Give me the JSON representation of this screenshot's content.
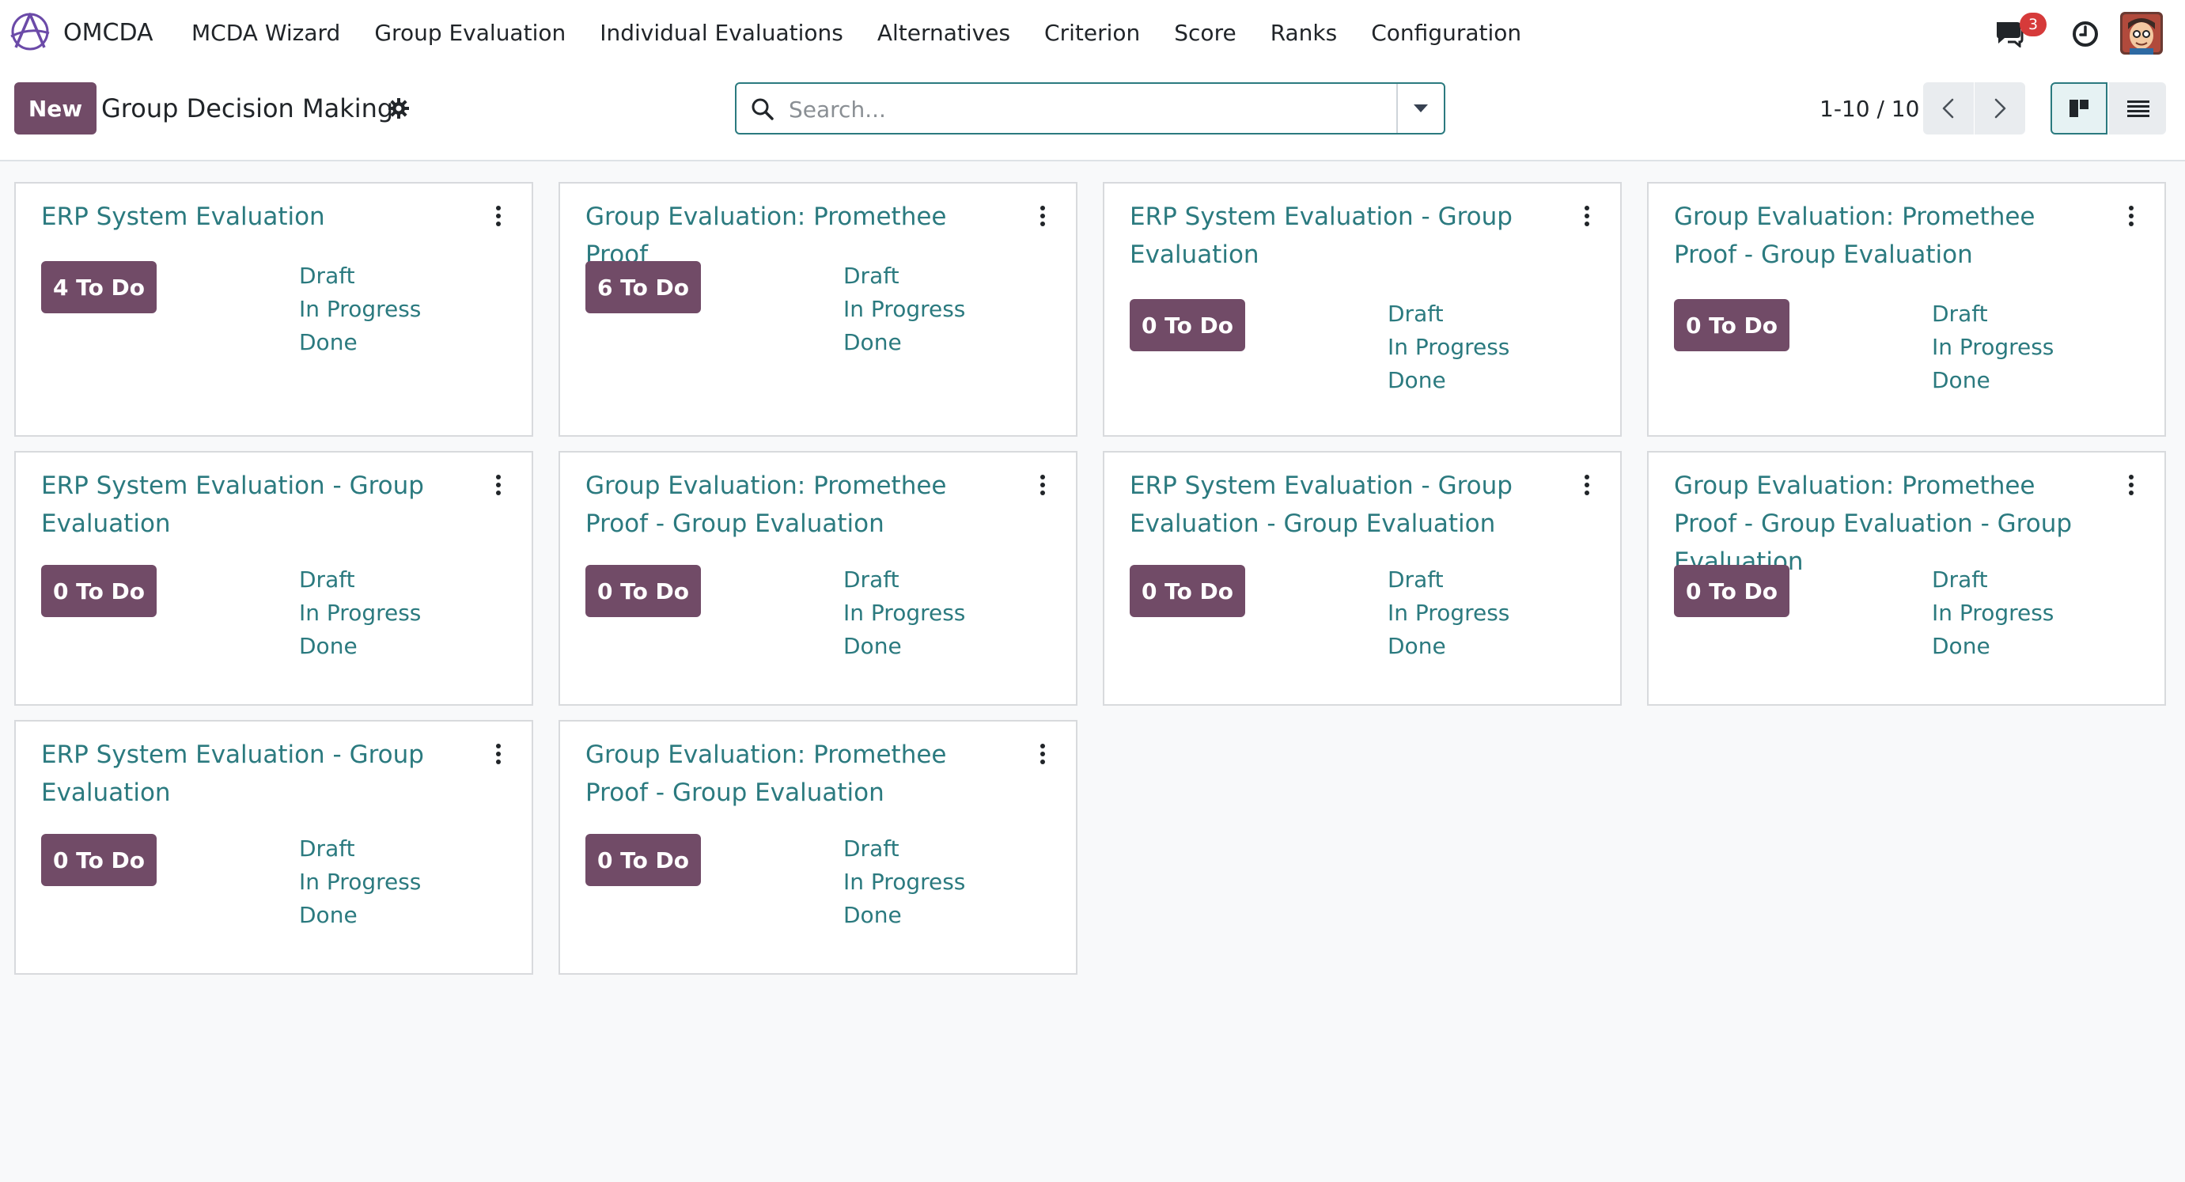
{
  "app": {
    "name": "OMCDA",
    "brand_color": "#714b67",
    "accent_color": "#2b7a7f",
    "menu": [
      {
        "label": "MCDA Wizard"
      },
      {
        "label": "Group Evaluation"
      },
      {
        "label": "Individual Evaluations"
      },
      {
        "label": "Alternatives"
      },
      {
        "label": "Criterion"
      },
      {
        "label": "Score"
      },
      {
        "label": "Ranks"
      },
      {
        "label": "Configuration"
      }
    ],
    "messages_badge": "3"
  },
  "control_panel": {
    "new_label": "New",
    "title": "Group Decision Making",
    "search_placeholder": "Search...",
    "pager_value": "1-10 / 10"
  },
  "cards": [
    {
      "title": "ERP System Evaluation",
      "todo": "4 To Do",
      "statuses": [
        "Draft",
        "In Progress",
        "Done"
      ]
    },
    {
      "title": "Group Evaluation: Promethee Proof",
      "todo": "6 To Do",
      "statuses": [
        "Draft",
        "In Progress",
        "Done"
      ]
    },
    {
      "title": "ERP System Evaluation - Group Evaluation",
      "todo": "0 To Do",
      "statuses": [
        "Draft",
        "In Progress",
        "Done"
      ]
    },
    {
      "title": "Group Evaluation: Promethee Proof - Group Evaluation",
      "todo": "0 To Do",
      "statuses": [
        "Draft",
        "In Progress",
        "Done"
      ]
    },
    {
      "title": "ERP System Evaluation - Group Evaluation",
      "todo": "0 To Do",
      "statuses": [
        "Draft",
        "In Progress",
        "Done"
      ]
    },
    {
      "title": "Group Evaluation: Promethee Proof - Group Evaluation",
      "todo": "0 To Do",
      "statuses": [
        "Draft",
        "In Progress",
        "Done"
      ]
    },
    {
      "title": "ERP System Evaluation - Group Evaluation - Group Evaluation",
      "todo": "0 To Do",
      "statuses": [
        "Draft",
        "In Progress",
        "Done"
      ]
    },
    {
      "title": "Group Evaluation: Promethee Proof - Group Evaluation - Group Evaluation",
      "todo": "0 To Do",
      "statuses": [
        "Draft",
        "In Progress",
        "Done"
      ]
    },
    {
      "title": "ERP System Evaluation - Group Evaluation",
      "todo": "0 To Do",
      "statuses": [
        "Draft",
        "In Progress",
        "Done"
      ]
    },
    {
      "title": "Group Evaluation: Promethee Proof - Group Evaluation",
      "todo": "0 To Do",
      "statuses": [
        "Draft",
        "In Progress",
        "Done"
      ]
    }
  ]
}
